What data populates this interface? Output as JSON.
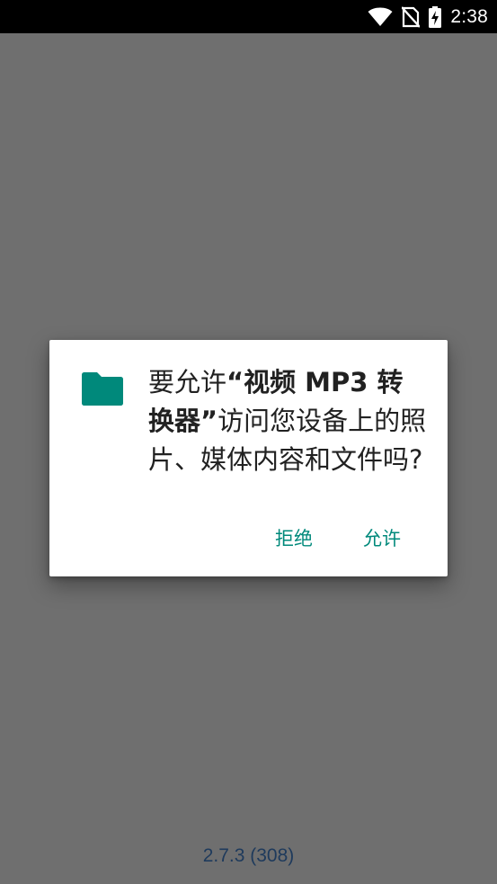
{
  "status_bar": {
    "time": "2:38",
    "icons": [
      "wifi-icon",
      "no-sim-icon",
      "battery-charging-icon"
    ]
  },
  "colors": {
    "scrim": "#6f6f6f",
    "accent": "#00897b",
    "folder_icon": "#00897b",
    "version_text": "#1e3a5c"
  },
  "dialog": {
    "icon": "folder-icon",
    "message_prefix": "要允许",
    "app_name": "“视频 MP3 转换器”",
    "message_suffix": "访问您设备上的照片、媒体内容和文件吗?",
    "deny_label": "拒绝",
    "allow_label": "允许"
  },
  "background": {
    "version": "2.7.3 (308)"
  }
}
